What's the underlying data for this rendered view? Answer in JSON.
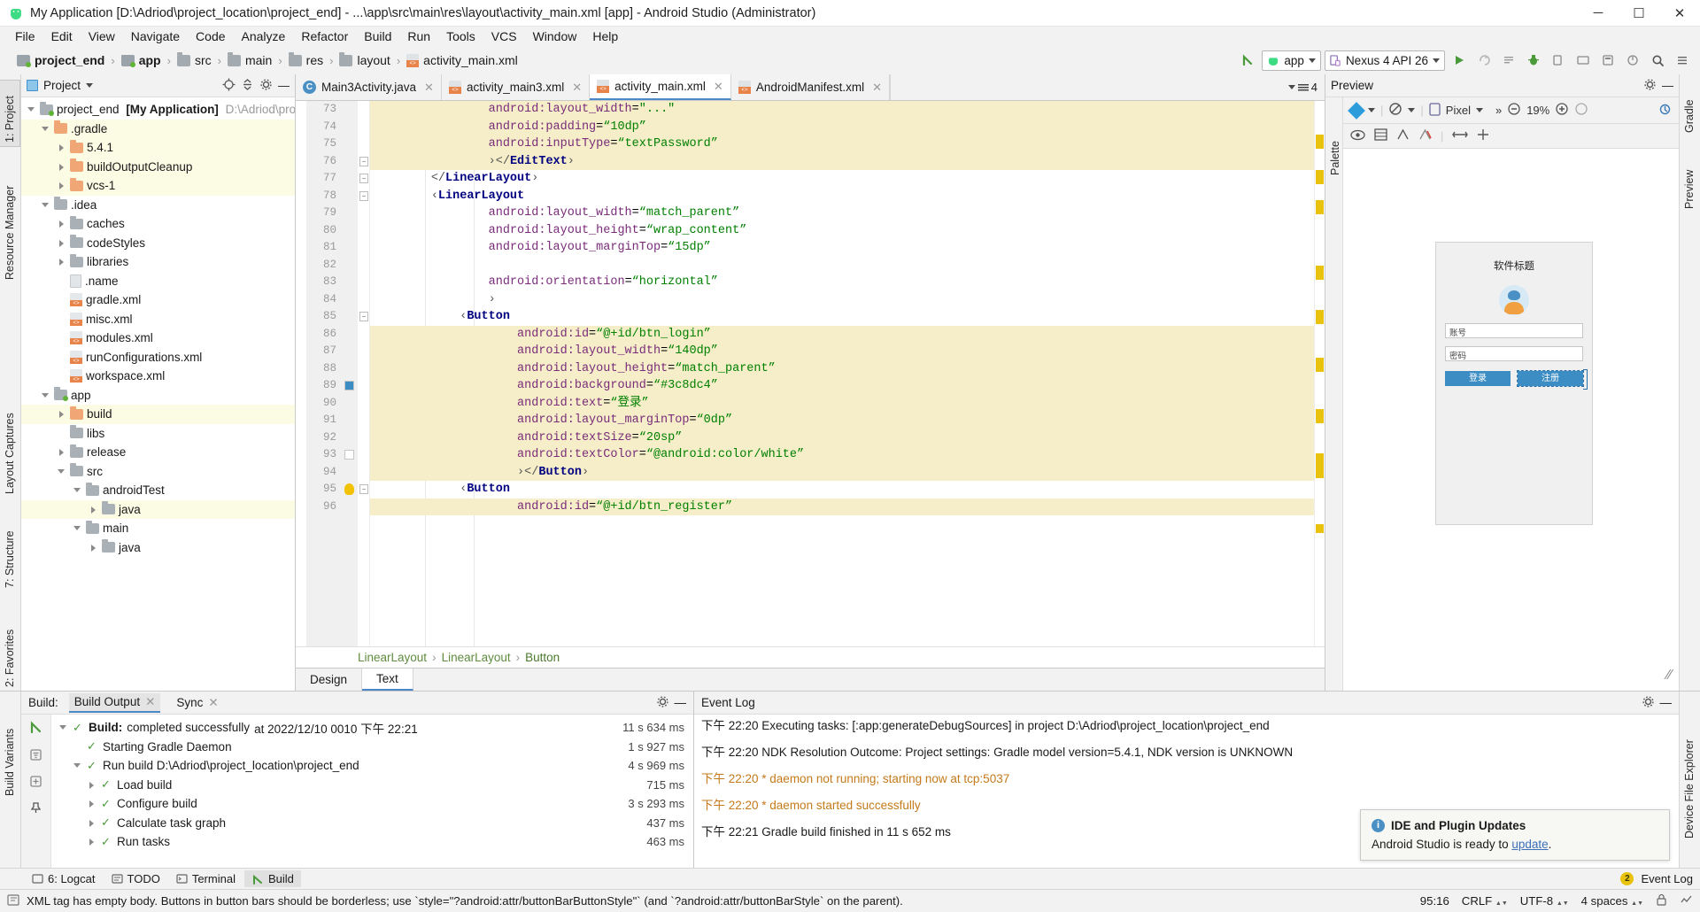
{
  "window": {
    "title": "My Application [D:\\Adriod\\project_location\\project_end] - ...\\app\\src\\main\\res\\layout\\activity_main.xml [app] - Android Studio (Administrator)",
    "minimize": "─",
    "maximize": "☐",
    "close": "✕"
  },
  "menubar": [
    {
      "label": "File"
    },
    {
      "label": "Edit"
    },
    {
      "label": "View"
    },
    {
      "label": "Navigate"
    },
    {
      "label": "Code"
    },
    {
      "label": "Analyze"
    },
    {
      "label": "Refactor"
    },
    {
      "label": "Build"
    },
    {
      "label": "Run"
    },
    {
      "label": "Tools"
    },
    {
      "label": "VCS"
    },
    {
      "label": "Window"
    },
    {
      "label": "Help"
    }
  ],
  "breadcrumbs": [
    {
      "label": "project_end",
      "icon": "module-folder-icon",
      "bold": true
    },
    {
      "label": "app",
      "icon": "module-folder-icon",
      "bold": true
    },
    {
      "label": "src",
      "icon": "folder-icon",
      "bold": false
    },
    {
      "label": "main",
      "icon": "folder-icon",
      "bold": false
    },
    {
      "label": "res",
      "icon": "res-folder-icon",
      "bold": false
    },
    {
      "label": "layout",
      "icon": "folder-icon",
      "bold": false
    },
    {
      "label": "activity_main.xml",
      "icon": "xml-file-icon",
      "bold": false
    }
  ],
  "toolbar": {
    "build_variant_label": "app",
    "device_label": "Nexus 4 API 26",
    "icons": [
      "sync-gradle-icon",
      "run-icon",
      "apply-changes-icon",
      "logcat-icon",
      "debug-icon",
      "device-manager-icon",
      "avd-manager-icon",
      "sdk-manager-icon",
      "profiler-icon",
      "search-icon",
      "more-icon"
    ]
  },
  "left_rail": [
    {
      "label": "1: Project",
      "selected": true
    },
    {
      "label": "Resource Manager",
      "selected": false
    },
    {
      "label": "Layout Captures",
      "selected": false
    },
    {
      "label": "7: Structure",
      "selected": false
    },
    {
      "label": "2: Favorites",
      "selected": false
    }
  ],
  "right_rail": [
    {
      "label": "Gradle"
    },
    {
      "label": "Preview"
    },
    {
      "label": "Device File Explorer"
    },
    {
      "label": "Build Variants"
    }
  ],
  "project_panel": {
    "title": "Project",
    "tree": [
      {
        "indent": 0,
        "arrow": "down",
        "icon": "project-folder-icon",
        "label": "project_end",
        "bold_label": "[My Application]",
        "dim": "D:\\Adriod\\pro",
        "hl": false
      },
      {
        "indent": 1,
        "arrow": "down",
        "icon": "folder-orange-icon",
        "label": ".gradle",
        "hl": true
      },
      {
        "indent": 2,
        "arrow": "right",
        "icon": "folder-orange-icon",
        "label": "5.4.1",
        "hl": true
      },
      {
        "indent": 2,
        "arrow": "right",
        "icon": "folder-orange-icon",
        "label": "buildOutputCleanup",
        "hl": true
      },
      {
        "indent": 2,
        "arrow": "right",
        "icon": "folder-orange-icon",
        "label": "vcs-1",
        "hl": true
      },
      {
        "indent": 1,
        "arrow": "down",
        "icon": "folder-grey-icon",
        "label": ".idea",
        "hl": false
      },
      {
        "indent": 2,
        "arrow": "right",
        "icon": "folder-grey-icon",
        "label": "caches",
        "hl": false
      },
      {
        "indent": 2,
        "arrow": "right",
        "icon": "folder-grey-icon",
        "label": "codeStyles",
        "hl": false
      },
      {
        "indent": 2,
        "arrow": "right",
        "icon": "folder-grey-icon",
        "label": "libraries",
        "hl": false
      },
      {
        "indent": 2,
        "arrow": "none",
        "icon": "file-icon",
        "label": ".name",
        "hl": false
      },
      {
        "indent": 2,
        "arrow": "none",
        "icon": "xml-file-icon",
        "label": "gradle.xml",
        "hl": false
      },
      {
        "indent": 2,
        "arrow": "none",
        "icon": "xml-file-icon",
        "label": "misc.xml",
        "hl": false
      },
      {
        "indent": 2,
        "arrow": "none",
        "icon": "xml-file-icon",
        "label": "modules.xml",
        "hl": false
      },
      {
        "indent": 2,
        "arrow": "none",
        "icon": "xml-file-icon",
        "label": "runConfigurations.xml",
        "hl": false
      },
      {
        "indent": 2,
        "arrow": "none",
        "icon": "xml-file-icon",
        "label": "workspace.xml",
        "hl": false
      },
      {
        "indent": 1,
        "arrow": "down",
        "icon": "module-folder-icon",
        "label": "app",
        "hl": false
      },
      {
        "indent": 2,
        "arrow": "right",
        "icon": "folder-orange-icon",
        "label": "build",
        "hl": true
      },
      {
        "indent": 2,
        "arrow": "none",
        "icon": "folder-grey-icon",
        "label": "libs",
        "hl": false
      },
      {
        "indent": 2,
        "arrow": "right",
        "icon": "folder-grey-icon",
        "label": "release",
        "hl": false
      },
      {
        "indent": 2,
        "arrow": "down",
        "icon": "folder-grey-icon",
        "label": "src",
        "hl": false
      },
      {
        "indent": 3,
        "arrow": "down",
        "icon": "folder-grey-icon",
        "label": "androidTest",
        "hl": false
      },
      {
        "indent": 4,
        "arrow": "right",
        "icon": "folder-green-icon",
        "label": "java",
        "hl": true
      },
      {
        "indent": 3,
        "arrow": "down",
        "icon": "folder-grey-icon",
        "label": "main",
        "hl": false
      },
      {
        "indent": 4,
        "arrow": "right",
        "icon": "folder-green-icon",
        "label": "java",
        "hl": false
      }
    ]
  },
  "editor": {
    "tabs": [
      {
        "label": "Main3Activity.java",
        "icon": "java-class-icon",
        "active": false
      },
      {
        "label": "activity_main3.xml",
        "icon": "xml-file-icon",
        "active": false
      },
      {
        "label": "activity_main.xml",
        "icon": "xml-file-icon",
        "active": true
      },
      {
        "label": "AndroidManifest.xml",
        "icon": "manifest-icon",
        "active": false
      }
    ],
    "tab_overflow_count": "4",
    "lines": [
      {
        "n": "73",
        "indent": 4,
        "hl": true,
        "tokens": [
          {
            "t": "android:layout_width",
            "c": "attr"
          },
          {
            "t": "=",
            "c": "eq"
          },
          {
            "t": "\"...\"",
            "c": "val"
          }
        ],
        "partial": true
      },
      {
        "n": "74",
        "indent": 4,
        "hl": true,
        "tokens": [
          {
            "t": "android:padding",
            "c": "attr"
          },
          {
            "t": "=",
            "c": "eq"
          },
          {
            "t": "“10dp”",
            "c": "val"
          }
        ]
      },
      {
        "n": "75",
        "indent": 4,
        "hl": true,
        "tokens": [
          {
            "t": "android:inputType",
            "c": "attr"
          },
          {
            "t": "=",
            "c": "eq"
          },
          {
            "t": "“textPassword”",
            "c": "val"
          }
        ]
      },
      {
        "n": "76",
        "indent": 4,
        "hl": true,
        "tokens": [
          {
            "t": "›",
            "c": "brack"
          },
          {
            "t": "</",
            "c": "brack"
          },
          {
            "t": "EditText",
            "c": "tag"
          },
          {
            "t": "›",
            "c": "brack"
          }
        ]
      },
      {
        "n": "77",
        "indent": 2,
        "hl": false,
        "tokens": [
          {
            "t": "</",
            "c": "brack"
          },
          {
            "t": "LinearLayout",
            "c": "tag"
          },
          {
            "t": "›",
            "c": "brack"
          }
        ]
      },
      {
        "n": "78",
        "indent": 2,
        "hl": false,
        "tokens": [
          {
            "t": "‹",
            "c": "brack"
          },
          {
            "t": "LinearLayout",
            "c": "tag"
          }
        ]
      },
      {
        "n": "79",
        "indent": 4,
        "hl": false,
        "tokens": [
          {
            "t": "android:layout_width",
            "c": "attr"
          },
          {
            "t": "=",
            "c": "eq"
          },
          {
            "t": "“match_parent”",
            "c": "val"
          }
        ]
      },
      {
        "n": "80",
        "indent": 4,
        "hl": false,
        "tokens": [
          {
            "t": "android:layout_height",
            "c": "attr"
          },
          {
            "t": "=",
            "c": "eq"
          },
          {
            "t": "“wrap_content”",
            "c": "val"
          }
        ]
      },
      {
        "n": "81",
        "indent": 4,
        "hl": false,
        "tokens": [
          {
            "t": "android:layout_marginTop",
            "c": "attr"
          },
          {
            "t": "=",
            "c": "eq"
          },
          {
            "t": "“15dp”",
            "c": "val"
          }
        ]
      },
      {
        "n": "82",
        "indent": 4,
        "hl": false,
        "tokens": []
      },
      {
        "n": "83",
        "indent": 4,
        "hl": false,
        "tokens": [
          {
            "t": "android:orientation",
            "c": "attr"
          },
          {
            "t": "=",
            "c": "eq"
          },
          {
            "t": "“horizontal”",
            "c": "val"
          }
        ]
      },
      {
        "n": "84",
        "indent": 4,
        "hl": false,
        "tokens": [
          {
            "t": "›",
            "c": "brack"
          }
        ]
      },
      {
        "n": "85",
        "indent": 3,
        "hl": false,
        "tokens": [
          {
            "t": "‹",
            "c": "brack"
          },
          {
            "t": "Button",
            "c": "tag"
          }
        ]
      },
      {
        "n": "86",
        "indent": 5,
        "hl": true,
        "tokens": [
          {
            "t": "android:id",
            "c": "attr"
          },
          {
            "t": "=",
            "c": "eq"
          },
          {
            "t": "“@+id/btn_login”",
            "c": "val"
          }
        ]
      },
      {
        "n": "87",
        "indent": 5,
        "hl": true,
        "tokens": [
          {
            "t": "android:layout_width",
            "c": "attr"
          },
          {
            "t": "=",
            "c": "eq"
          },
          {
            "t": "“140dp”",
            "c": "val"
          }
        ]
      },
      {
        "n": "88",
        "indent": 5,
        "hl": true,
        "tokens": [
          {
            "t": "android:layout_height",
            "c": "attr"
          },
          {
            "t": "=",
            "c": "eq"
          },
          {
            "t": "“match_parent”",
            "c": "val"
          }
        ]
      },
      {
        "n": "89",
        "indent": 5,
        "hl": true,
        "gutter_swatch": "#3c8dc4",
        "tokens": [
          {
            "t": "android:background",
            "c": "attr"
          },
          {
            "t": "=",
            "c": "eq"
          },
          {
            "t": "“#3c8dc4”",
            "c": "val"
          }
        ]
      },
      {
        "n": "90",
        "indent": 5,
        "hl": true,
        "tokens": [
          {
            "t": "android:text",
            "c": "attr"
          },
          {
            "t": "=",
            "c": "eq"
          },
          {
            "t": "“登录”",
            "c": "val"
          }
        ]
      },
      {
        "n": "91",
        "indent": 5,
        "hl": true,
        "tokens": [
          {
            "t": "android:layout_marginTop",
            "c": "attr"
          },
          {
            "t": "=",
            "c": "eq"
          },
          {
            "t": "“0dp”",
            "c": "val"
          }
        ]
      },
      {
        "n": "92",
        "indent": 5,
        "hl": true,
        "tokens": [
          {
            "t": "android:textSize",
            "c": "attr"
          },
          {
            "t": "=",
            "c": "eq"
          },
          {
            "t": "“20sp”",
            "c": "val"
          }
        ]
      },
      {
        "n": "93",
        "indent": 5,
        "hl": true,
        "gutter_swatch": "#ffffff",
        "tokens": [
          {
            "t": "android:textColor",
            "c": "attr"
          },
          {
            "t": "=",
            "c": "eq"
          },
          {
            "t": "“@android:color/white”",
            "c": "val"
          }
        ]
      },
      {
        "n": "94",
        "indent": 5,
        "hl": true,
        "tokens": [
          {
            "t": "›</",
            "c": "brack"
          },
          {
            "t": "Button",
            "c": "tag"
          },
          {
            "t": "›",
            "c": "brack"
          }
        ]
      },
      {
        "n": "95",
        "indent": 3,
        "hl": false,
        "bulb": true,
        "tokens": [
          {
            "t": "‹",
            "c": "brack"
          },
          {
            "t": "Button",
            "c": "tag"
          }
        ]
      },
      {
        "n": "96",
        "indent": 5,
        "hl": true,
        "tokens": [
          {
            "t": "android:id",
            "c": "attr"
          },
          {
            "t": "=",
            "c": "eq"
          },
          {
            "t": "“@+id/btn_register”",
            "c": "val"
          }
        ]
      }
    ],
    "component_breadcrumb": [
      "LinearLayout",
      "LinearLayout",
      "Button"
    ],
    "design_text_tabs": [
      {
        "label": "Design",
        "active": false
      },
      {
        "label": "Text",
        "active": true
      }
    ]
  },
  "preview": {
    "title": "Preview",
    "palette_label": "Palette",
    "zoom_level": "19%",
    "device_label": "Pixel",
    "overflow": "»",
    "toolbar_icons": [
      "layers-icon",
      "orientation-icon",
      "device-icon",
      "chevron-right-icon",
      "zoom-out-icon",
      "zoom-fit-icon",
      "zoom-in-icon",
      "zoom-actual-icon",
      "settings-icon"
    ],
    "toolbar2_icons": [
      "eye-icon",
      "blueprint-icon",
      "constraints-icon",
      "clear-constraints-icon",
      "horizontal-align-icon",
      "vertical-align-icon"
    ],
    "render": {
      "app_title": "软件标题",
      "avatar": "user-avatar-icon",
      "field_account": "账号",
      "field_password": "密码",
      "btn_login": "登录",
      "btn_register": "注册",
      "btn_color": "#3c8dc4"
    }
  },
  "build_panel": {
    "label": "Build:",
    "tabs": [
      {
        "label": "Build Output",
        "closable": true,
        "selected": true
      },
      {
        "label": "Sync",
        "closable": true,
        "selected": false
      }
    ],
    "rows": [
      {
        "indent": 0,
        "arrow": "down",
        "check": true,
        "bold": "Build:",
        "text": " completed successfully",
        "dim": " at 2022/12/10 0010 下午 22:21",
        "time": "11 s 634 ms"
      },
      {
        "indent": 1,
        "arrow": "none",
        "check": true,
        "text": "Starting Gradle Daemon",
        "time": "1 s 927 ms"
      },
      {
        "indent": 1,
        "arrow": "down",
        "check": true,
        "text": "Run build D:\\Adriod\\project_location\\project_end",
        "time": "4 s 969 ms"
      },
      {
        "indent": 2,
        "arrow": "right",
        "check": true,
        "text": "Load build",
        "time": "715 ms"
      },
      {
        "indent": 2,
        "arrow": "right",
        "check": true,
        "text": "Configure build",
        "time": "3 s 293 ms"
      },
      {
        "indent": 2,
        "arrow": "right",
        "check": true,
        "text": "Calculate task graph",
        "time": "437 ms"
      },
      {
        "indent": 2,
        "arrow": "right",
        "check": true,
        "text": "Run tasks",
        "time": "463 ms"
      }
    ]
  },
  "event_log": {
    "title": "Event Log",
    "rows": [
      {
        "text": "下午 22:20 Executing tasks: [:app:generateDebugSources] in project D:\\Adriod\\project_location\\project_end",
        "style": "normal",
        "clipped": true
      },
      {
        "text": "下午 22:20 NDK Resolution Outcome: Project settings: Gradle model version=5.4.1, NDK version is UNKNOWN",
        "style": "normal"
      },
      {
        "text": "下午 22:20 * daemon not running; starting now at tcp:5037",
        "style": "orange"
      },
      {
        "text": "下午 22:20 * daemon started successfully",
        "style": "orange"
      },
      {
        "text": "下午 22:21 Gradle build finished in 11 s 652 ms",
        "style": "normal"
      }
    ],
    "toast": {
      "title": "IDE and Plugin Updates",
      "body": "Android Studio is ready to ",
      "link": "update",
      "suffix": "."
    }
  },
  "toolwindow_bar": {
    "items": [
      {
        "label": "6: Logcat",
        "icon": "logcat-icon",
        "selected": false
      },
      {
        "label": "TODO",
        "icon": "todo-icon",
        "selected": false
      },
      {
        "label": "Terminal",
        "icon": "terminal-icon",
        "selected": false
      },
      {
        "label": "Build",
        "icon": "build-icon",
        "selected": true
      }
    ],
    "right": {
      "badge": "2",
      "label": "Event Log"
    }
  },
  "statusbar": {
    "message": "XML tag has empty body. Buttons in button bars should be borderless; use `style=\"?android:attr/buttonBarButtonStyle\"` (and `?android:attr/buttonBarStyle` on the parent).",
    "caret": "95:16",
    "line_sep": "CRLF",
    "encoding": "UTF-8",
    "indent": "4 spaces"
  }
}
